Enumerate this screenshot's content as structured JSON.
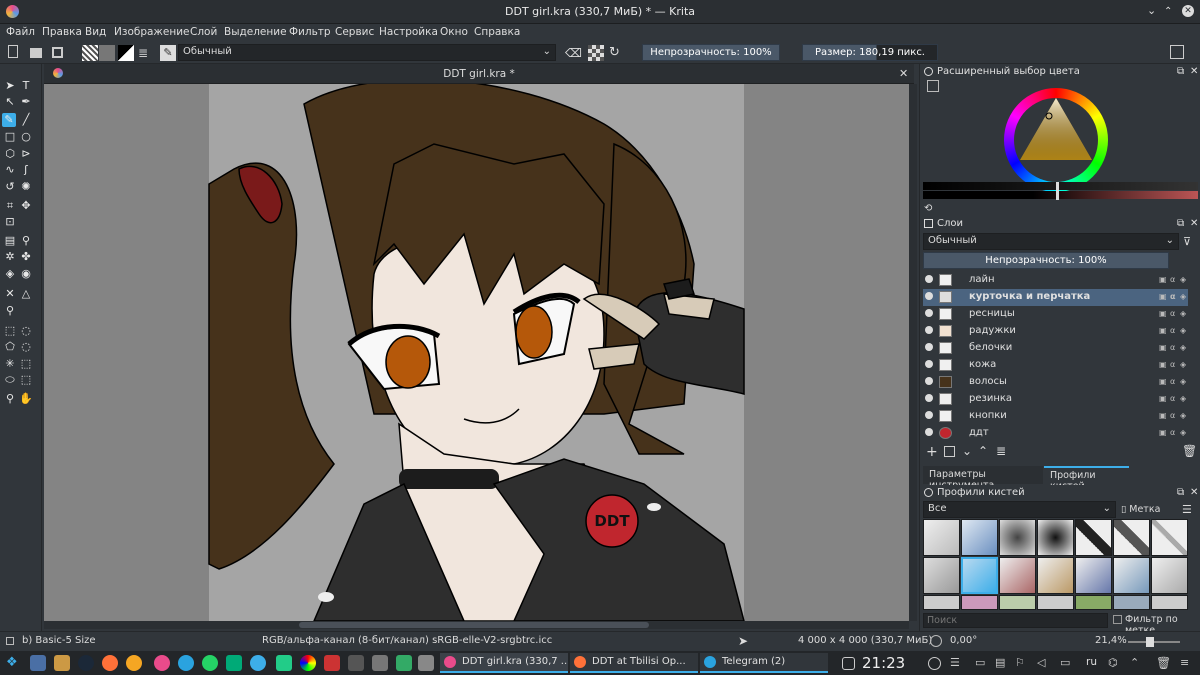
{
  "window": {
    "title": "DDT girl.kra (330,7 МиБ) * — Krita"
  },
  "menu": [
    "Файл",
    "Правка",
    "Вид",
    "Изображение",
    "Слой",
    "Выделение",
    "Фильтр",
    "Сервис",
    "Настройка",
    "Окно",
    "Справка"
  ],
  "toolbar": {
    "blend_mode": "Обычный",
    "opacity": "Непрозрачность: 100%",
    "size": "Размер: 180,19 пикс."
  },
  "document": {
    "tab_title": "DDT girl.kra *"
  },
  "color_docker": {
    "title": "Расширенный выбор цвета"
  },
  "layers_docker": {
    "title": "Слои",
    "blend_mode": "Обычный",
    "opacity": "Непрозрачность:  100%",
    "layers": [
      "лайн",
      "курточка и перчатка",
      "ресницы",
      "радужки",
      "белочки",
      "кожа",
      "волосы",
      "резинка",
      "кнопки",
      "ддт"
    ],
    "active_index": 1
  },
  "tabs": {
    "tool_options": "Параметры инструмента",
    "brush_presets": "Профили кистей"
  },
  "brush_docker": {
    "title": "Профили кистей",
    "filter": "Все",
    "tag_label": "Метка",
    "search_placeholder": "Поиск",
    "filter_by_tag": "Фильтр по метке"
  },
  "status": {
    "brush": "b) Basic-5 Size",
    "color_model": "RGB/альфа-канал (8-бит/канал)  sRGB-elle-V2-srgbtrc.icc",
    "dimensions": "4 000 x 4 000 (330,7 МиБ)",
    "rotation": "0,00°",
    "zoom": "21,4%"
  },
  "taskbar": {
    "tasks": [
      "DDT girl.kra (330,7 ...",
      "DDT at Tbilisi Op...",
      "Telegram (2)"
    ],
    "clock": "21:23",
    "lang": "ru"
  },
  "colors": {
    "accent": "#3daee9",
    "selected_layer": "#4b6480",
    "hair": "#46321b",
    "jacket": "#2e2e2e",
    "skin": "#f1e6dd",
    "iris": "#b5580a",
    "badge": "#c0262e"
  }
}
